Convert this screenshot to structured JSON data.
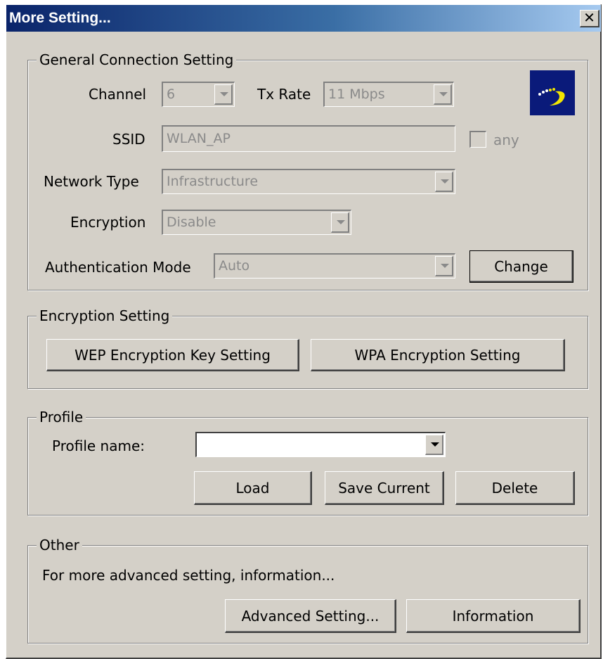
{
  "window": {
    "title": "More Setting...",
    "close_glyph": "✕"
  },
  "general": {
    "legend": "General Connection Setting",
    "channel_label": "Channel",
    "channel_value": "6",
    "txrate_label": "Tx Rate",
    "txrate_value": "11 Mbps",
    "ssid_label": "SSID",
    "ssid_value": "WLAN_AP",
    "any_label": "any",
    "network_type_label": "Network Type",
    "network_type_value": "Infrastructure",
    "encryption_label": "Encryption",
    "encryption_value": "Disable",
    "auth_mode_label": "Authentication Mode",
    "auth_mode_value": "Auto",
    "change_button": "Change",
    "logo_icon": "wireless-logo-icon",
    "logo_colors": {
      "background": "#0a1a7a",
      "arc": "#f2e600"
    }
  },
  "encryption_setting": {
    "legend": "Encryption Setting",
    "wep_button": "WEP Encryption Key Setting",
    "wpa_button": "WPA Encryption Setting"
  },
  "profile": {
    "legend": "Profile",
    "name_label": "Profile name:",
    "name_value": "",
    "load_button": "Load",
    "save_button": "Save Current",
    "delete_button": "Delete"
  },
  "other": {
    "legend": "Other",
    "description": "For more advanced setting, information...",
    "advanced_button": "Advanced Setting...",
    "information_button": "Information"
  }
}
